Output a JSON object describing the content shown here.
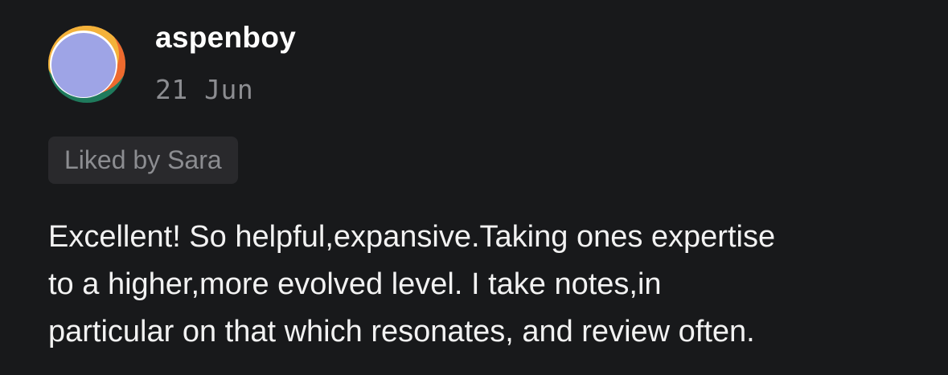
{
  "review": {
    "author": "aspenboy",
    "date": "21 Jun",
    "liked_by": "Liked by Sara",
    "body_lines": [
      "Excellent! So helpful,expansive.Taking ones expertise",
      "to a higher,more evolved level. I take notes,in",
      "particular on that which resonates, and review often."
    ]
  },
  "colors": {
    "background": "#18191b",
    "author_text": "#ffffff",
    "muted_text": "#8c8d91",
    "chip_background": "#29292c",
    "avatar_fill": "#9ea4e6",
    "avatar_accent_yellow": "#f4b23a",
    "avatar_accent_orange": "#ee6a2e",
    "avatar_accent_green": "#1f7a5c"
  },
  "icons": {
    "avatar": "abstract-user-avatar"
  }
}
